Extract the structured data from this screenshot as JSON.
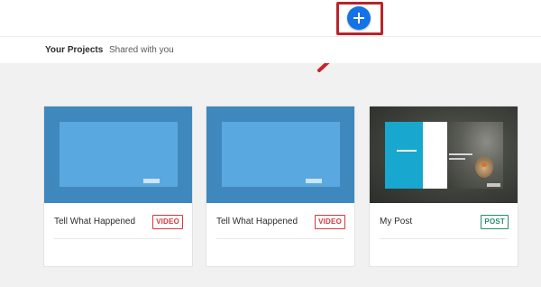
{
  "header": {
    "add_button_icon": "plus-icon",
    "accent_color": "#1473e6",
    "highlight_color": "#b8242b"
  },
  "tabs": [
    {
      "label": "Your Projects",
      "active": true
    },
    {
      "label": "Shared with you",
      "active": false
    }
  ],
  "projects": [
    {
      "title": "Tell What Happened",
      "type": "VIDEO",
      "type_color": "#d7373f"
    },
    {
      "title": "Tell What Happened",
      "type": "VIDEO",
      "type_color": "#d7373f"
    },
    {
      "title": "My Post",
      "type": "POST",
      "type_color": "#268e6c"
    }
  ]
}
